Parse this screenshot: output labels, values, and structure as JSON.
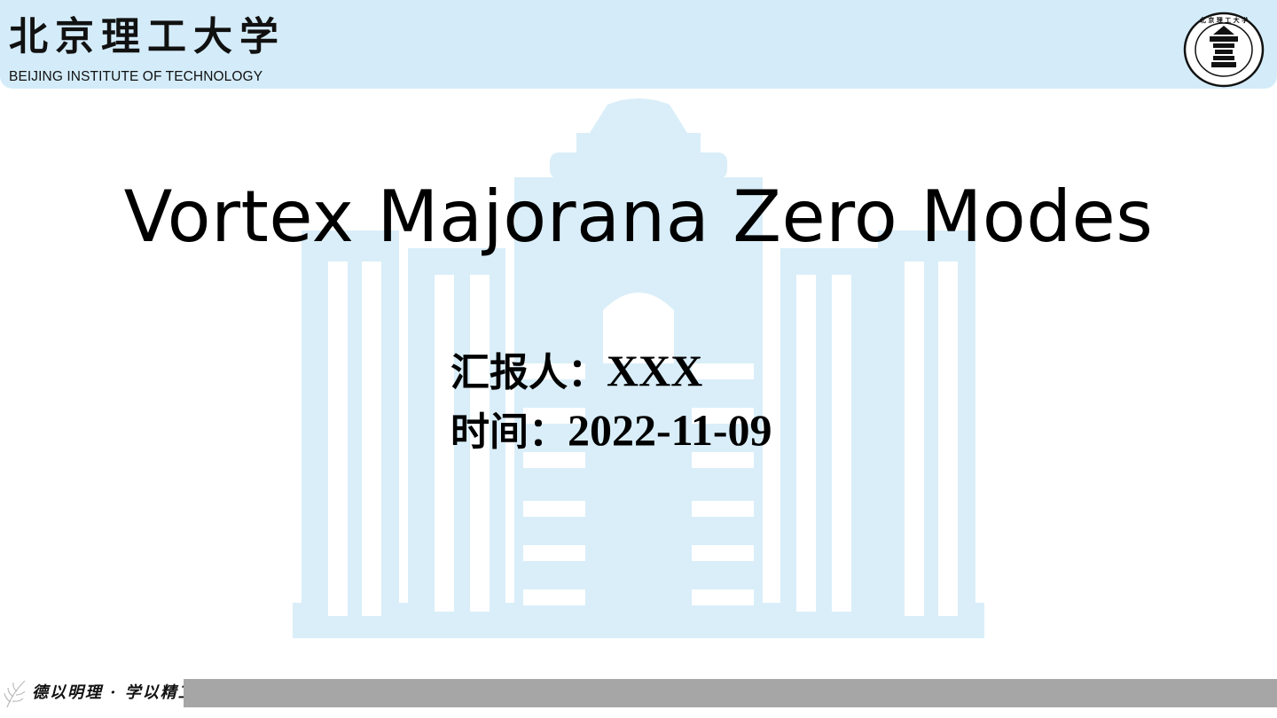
{
  "header": {
    "school_name_cn": "北京理工大学",
    "school_name_en": "BEIJING INSTITUTE OF TECHNOLOGY",
    "seal_text": "BEIJING INSTITUTE OF TECHNOLOGY",
    "background_color": "#d4ecf9"
  },
  "slide": {
    "title": "Vortex Majorana Zero Modes",
    "presenter_label": "汇报人：",
    "presenter_value": "XXX",
    "time_label": "时间：",
    "time_value": "2022-11-09"
  },
  "footer": {
    "motto": "德以明理 · 学以精工",
    "bar_color": "#a6a6a6"
  },
  "watermark": {
    "icon": "building-watermark-icon",
    "color": "#d9eef8"
  }
}
